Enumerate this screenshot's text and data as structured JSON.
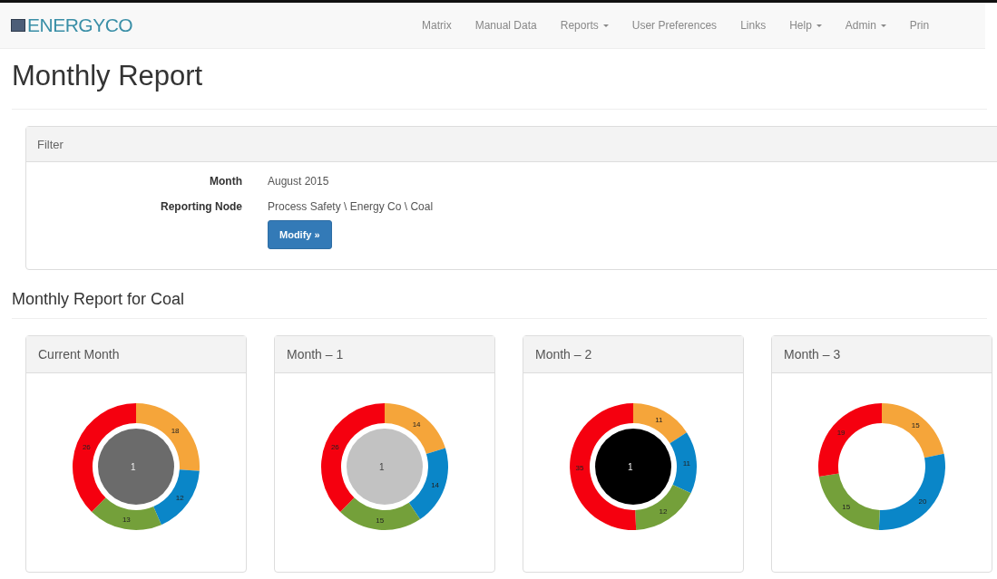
{
  "brand": "ENERGYCO",
  "nav": [
    {
      "label": "Matrix",
      "dropdown": false
    },
    {
      "label": "Manual Data",
      "dropdown": false
    },
    {
      "label": "Reports",
      "dropdown": true
    },
    {
      "label": "User Preferences",
      "dropdown": false
    },
    {
      "label": "Links",
      "dropdown": false
    },
    {
      "label": "Help",
      "dropdown": true
    },
    {
      "label": "Admin",
      "dropdown": true
    },
    {
      "label": "Prin",
      "dropdown": false
    }
  ],
  "page_title": "Monthly Report",
  "filter": {
    "title": "Filter",
    "fields": [
      {
        "label": "Month",
        "value": "August 2015"
      },
      {
        "label": "Reporting Node",
        "value": "Process Safety \\ Energy Co \\ Coal"
      }
    ],
    "button": "Modify »"
  },
  "section_title": "Monthly Report for Coal",
  "cards": [
    {
      "title": "Current Month",
      "center": {
        "label": "1",
        "color": "#6b6b6b"
      },
      "chart_data": {
        "type": "donut",
        "data_labels": true,
        "values": [
          18,
          12,
          13,
          26
        ],
        "colors": [
          "#f5a53a",
          "#0a86c8",
          "#74a03a",
          "#f5000f"
        ]
      }
    },
    {
      "title": "Month – 1",
      "center": {
        "label": "1",
        "color": "#c2c2c2"
      },
      "chart_data": {
        "type": "donut",
        "data_labels": true,
        "values": [
          14,
          14,
          15,
          26
        ],
        "colors": [
          "#f5a53a",
          "#0a86c8",
          "#74a03a",
          "#f5000f"
        ]
      }
    },
    {
      "title": "Month – 2",
      "center": {
        "label": "1",
        "color": "#000000"
      },
      "chart_data": {
        "type": "donut",
        "data_labels": true,
        "values": [
          11,
          11,
          12,
          35
        ],
        "colors": [
          "#f5a53a",
          "#0a86c8",
          "#74a03a",
          "#f5000f"
        ]
      }
    },
    {
      "title": "Month – 3",
      "chart_data": {
        "type": "donut",
        "data_labels": true,
        "values": [
          15,
          20,
          15,
          19
        ],
        "colors": [
          "#f5a53a",
          "#0a86c8",
          "#74a03a",
          "#f5000f"
        ]
      }
    }
  ]
}
